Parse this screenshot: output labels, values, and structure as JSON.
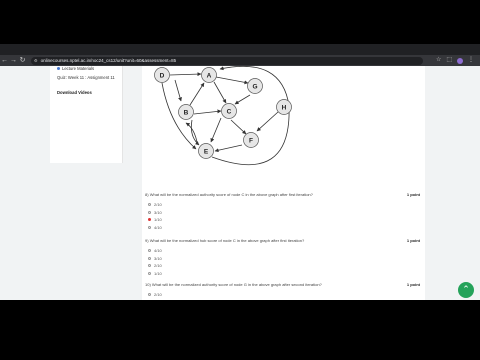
{
  "browser": {
    "url": "onlinecourses.nptel.ac.in/noc24_cs12/unit?unit=60&assessment=85",
    "icons": [
      "back-icon",
      "forward-icon",
      "reload-icon",
      "site-info-icon",
      "bookmark-star-icon",
      "extensions-icon",
      "profile-avatar",
      "menu-icon"
    ]
  },
  "sidebar": {
    "items": [
      {
        "label": "Lecture Materials"
      },
      {
        "label": "Quiz: Week 11 : Assignment 11"
      },
      {
        "label": "Download Videos"
      }
    ]
  },
  "graph": {
    "nodes": [
      {
        "id": "D"
      },
      {
        "id": "A"
      },
      {
        "id": "G"
      },
      {
        "id": "B"
      },
      {
        "id": "C"
      },
      {
        "id": "H"
      },
      {
        "id": "F"
      },
      {
        "id": "E"
      }
    ]
  },
  "questions": [
    {
      "number": "8)",
      "text": "What will be the normalized authority score of node C in the above graph after first iteration?",
      "points": "1 point",
      "options": [
        "2/10",
        "3/10",
        "1/10",
        "4/10"
      ],
      "selected_index": 2
    },
    {
      "number": "9)",
      "text": "What will be the normalized hub score of node C in the above graph after first iteration?",
      "points": "1 point",
      "options": [
        "4/10",
        "3/10",
        "2/10",
        "1/10"
      ]
    },
    {
      "number": "10)",
      "text": "What will be the normalized authority score of node G in the above graph after second iteration?",
      "points": "1 point",
      "options": [
        "2/10",
        "4/10"
      ]
    }
  ],
  "colors": {
    "accent": "#25a25a",
    "selected_radio": "#dd3333"
  }
}
